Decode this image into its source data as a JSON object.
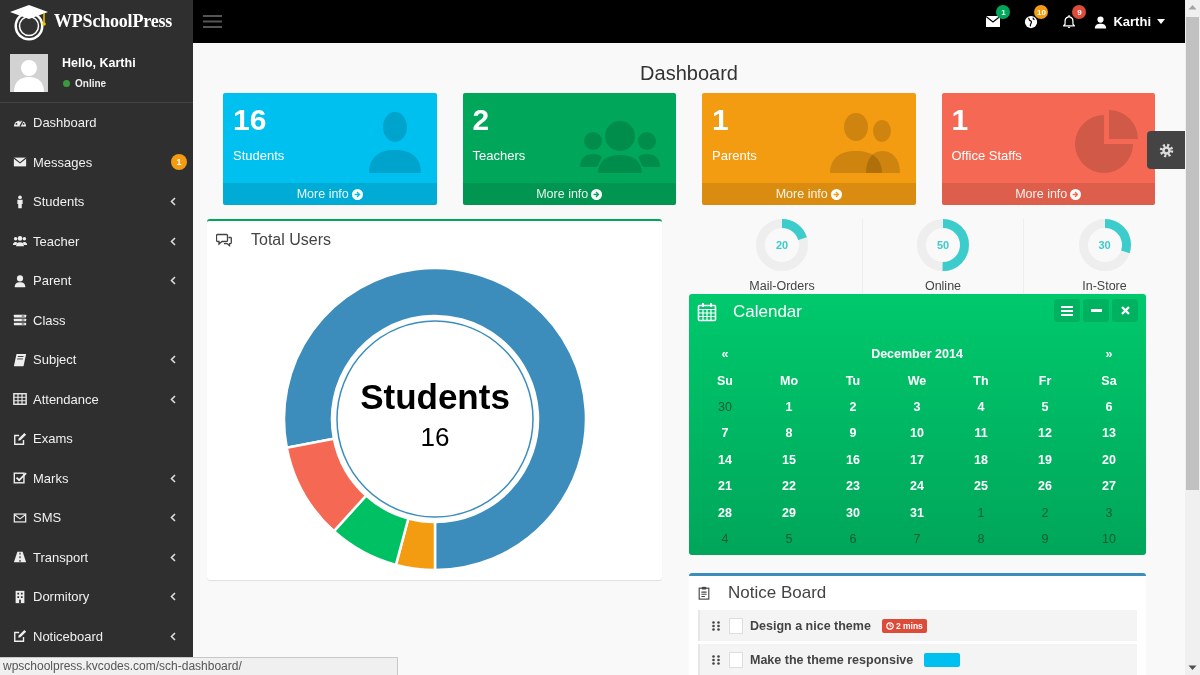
{
  "brand": {
    "name": "WPSchoolPress"
  },
  "topbar": {
    "notifications": [
      {
        "count": "1",
        "color": "#00a65a"
      },
      {
        "count": "10",
        "color": "#f39c12"
      },
      {
        "count": "9",
        "color": "#dd4b39"
      }
    ],
    "user_name": "Karthi"
  },
  "user_panel": {
    "greeting": "Hello, Karthi",
    "status": "Online",
    "online": true
  },
  "sidebar": {
    "items": [
      {
        "label": "Dashboard",
        "has_submenu": false
      },
      {
        "label": "Messages",
        "has_submenu": false,
        "badge": "1"
      },
      {
        "label": "Students",
        "has_submenu": true
      },
      {
        "label": "Teacher",
        "has_submenu": true
      },
      {
        "label": "Parent",
        "has_submenu": true
      },
      {
        "label": "Class",
        "has_submenu": false
      },
      {
        "label": "Subject",
        "has_submenu": true
      },
      {
        "label": "Attendance",
        "has_submenu": true
      },
      {
        "label": "Exams",
        "has_submenu": false
      },
      {
        "label": "Marks",
        "has_submenu": true
      },
      {
        "label": "SMS",
        "has_submenu": true
      },
      {
        "label": "Transport",
        "has_submenu": true
      },
      {
        "label": "Dormitory",
        "has_submenu": true
      },
      {
        "label": "Noticeboard",
        "has_submenu": true
      }
    ]
  },
  "page_title": "Dashboard",
  "stat_cards": [
    {
      "value": "16",
      "label": "Students",
      "link": "More info",
      "color": "#00c0ef"
    },
    {
      "value": "2",
      "label": "Teachers",
      "link": "More info",
      "color": "#00a65a"
    },
    {
      "value": "1",
      "label": "Parents",
      "link": "More info",
      "color": "#f39c12"
    },
    {
      "value": "1",
      "label": "Office Staffs",
      "link": "More info",
      "color": "#f56954"
    }
  ],
  "total_users": {
    "title": "Total Users",
    "center_label": "Students",
    "center_value": "16"
  },
  "knobs": [
    {
      "value": "20",
      "label": "Mail-Orders",
      "level": 0.2
    },
    {
      "value": "50",
      "label": "Online",
      "level": 0.5
    },
    {
      "value": "30",
      "label": "In-Store",
      "level": 0.3
    }
  ],
  "calendar": {
    "title": "Calendar",
    "prev": "«",
    "month": "December 2014",
    "next": "»",
    "weekdays": [
      "Su",
      "Mo",
      "Tu",
      "We",
      "Th",
      "Fr",
      "Sa"
    ],
    "weeks": [
      [
        {
          "label": "30",
          "muted": true
        },
        {
          "label": "1",
          "muted": false
        },
        {
          "label": "2",
          "muted": false
        },
        {
          "label": "3",
          "muted": false
        },
        {
          "label": "4",
          "muted": false
        },
        {
          "label": "5",
          "muted": false
        },
        {
          "label": "6",
          "muted": false
        }
      ],
      [
        {
          "label": "7",
          "muted": false
        },
        {
          "label": "8",
          "muted": false
        },
        {
          "label": "9",
          "muted": false
        },
        {
          "label": "10",
          "muted": false
        },
        {
          "label": "11",
          "muted": false
        },
        {
          "label": "12",
          "muted": false
        },
        {
          "label": "13",
          "muted": false
        }
      ],
      [
        {
          "label": "14",
          "muted": false
        },
        {
          "label": "15",
          "muted": false
        },
        {
          "label": "16",
          "muted": false
        },
        {
          "label": "17",
          "muted": false
        },
        {
          "label": "18",
          "muted": false
        },
        {
          "label": "19",
          "muted": false
        },
        {
          "label": "20",
          "muted": false
        }
      ],
      [
        {
          "label": "21",
          "muted": false
        },
        {
          "label": "22",
          "muted": false
        },
        {
          "label": "23",
          "muted": false
        },
        {
          "label": "24",
          "muted": false
        },
        {
          "label": "25",
          "muted": false
        },
        {
          "label": "26",
          "muted": false
        },
        {
          "label": "27",
          "muted": false
        }
      ],
      [
        {
          "label": "28",
          "muted": false
        },
        {
          "label": "29",
          "muted": false
        },
        {
          "label": "30",
          "muted": false
        },
        {
          "label": "31",
          "muted": false
        },
        {
          "label": "1",
          "muted": true
        },
        {
          "label": "2",
          "muted": true
        },
        {
          "label": "3",
          "muted": true
        }
      ],
      [
        {
          "label": "4",
          "muted": true
        },
        {
          "label": "5",
          "muted": true
        },
        {
          "label": "6",
          "muted": true
        },
        {
          "label": "7",
          "muted": true
        },
        {
          "label": "8",
          "muted": true
        },
        {
          "label": "9",
          "muted": true
        },
        {
          "label": "10",
          "muted": true
        }
      ]
    ]
  },
  "notice_board": {
    "title": "Notice Board",
    "items": [
      {
        "text": "Design a nice theme",
        "checked": false,
        "badge": "2 mins",
        "color": "#dd4b39"
      },
      {
        "text": "Make the theme responsive",
        "checked": false,
        "color": "#00c0ef"
      }
    ]
  },
  "status_bar": {
    "url": "wpschoolpress.kvcodes.com/sch-dashboard/"
  }
}
